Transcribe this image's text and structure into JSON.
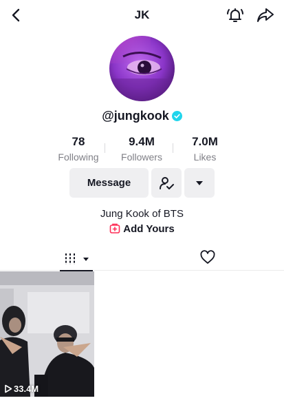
{
  "header": {
    "title": "JK",
    "back_icon": "chevron-left-icon",
    "bell_icon": "bell-icon",
    "share_icon": "share-arrow-icon"
  },
  "profile": {
    "handle": "@jungkook",
    "verified": true,
    "verified_color": "#20d5ec"
  },
  "stats": [
    {
      "value": "78",
      "label": "Following"
    },
    {
      "value": "9.4M",
      "label": "Followers"
    },
    {
      "value": "7.0M",
      "label": "Likes"
    }
  ],
  "actions": {
    "message_label": "Message",
    "follow_icon": "user-check-icon",
    "more_icon": "caret-down-icon"
  },
  "bio": {
    "text": "Jung Kook of BTS",
    "add_yours_label": "Add Yours",
    "add_yours_color": "#fe2c55"
  },
  "tabs": {
    "videos_icon": "grid-icon",
    "liked_icon": "heart-outline-icon"
  },
  "videos": [
    {
      "views": "33.4M"
    }
  ]
}
